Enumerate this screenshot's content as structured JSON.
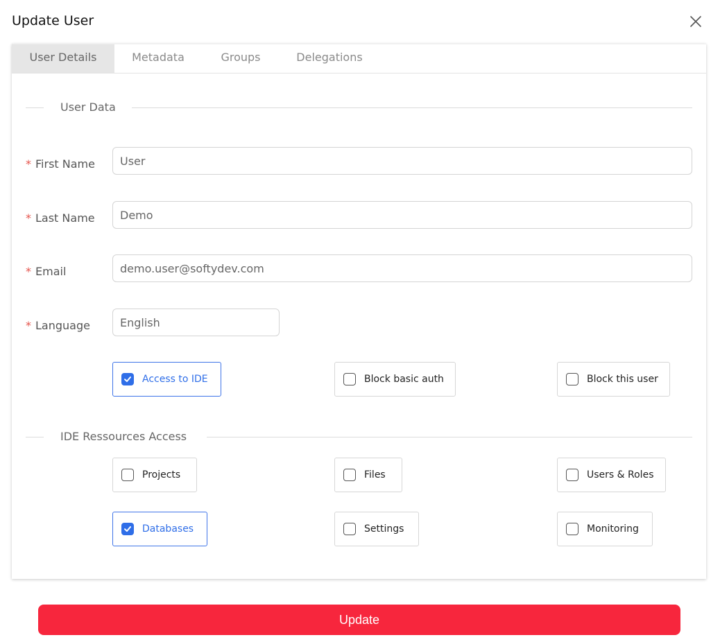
{
  "dialog": {
    "title": "Update User"
  },
  "tabs": [
    {
      "label": "User Details",
      "active": true
    },
    {
      "label": "Metadata",
      "active": false
    },
    {
      "label": "Groups",
      "active": false
    },
    {
      "label": "Delegations",
      "active": false
    }
  ],
  "user_data": {
    "section_title": "User Data",
    "required_marker": "*",
    "first_name": {
      "label": "First Name",
      "value": "User"
    },
    "last_name": {
      "label": "Last Name",
      "value": "Demo"
    },
    "email": {
      "label": "Email",
      "value": "demo.user@softydev.com"
    },
    "language": {
      "label": "Language",
      "value": "English"
    },
    "options": [
      {
        "label": "Access to IDE",
        "checked": true
      },
      {
        "label": "Block basic auth",
        "checked": false
      },
      {
        "label": "Block this user",
        "checked": false
      }
    ]
  },
  "ide_access": {
    "section_title": "IDE Ressources Access",
    "options": [
      {
        "label": "Projects",
        "checked": false
      },
      {
        "label": "Files",
        "checked": false
      },
      {
        "label": "Users & Roles",
        "checked": false
      },
      {
        "label": "Databases",
        "checked": true
      },
      {
        "label": "Settings",
        "checked": false
      },
      {
        "label": "Monitoring",
        "checked": false
      }
    ]
  },
  "actions": {
    "update_label": "Update"
  },
  "colors": {
    "accent": "#2f6ee8",
    "danger": "#f7263d",
    "required": "#e5534b"
  },
  "icons": {
    "close": "close-icon",
    "check": "check-icon"
  }
}
